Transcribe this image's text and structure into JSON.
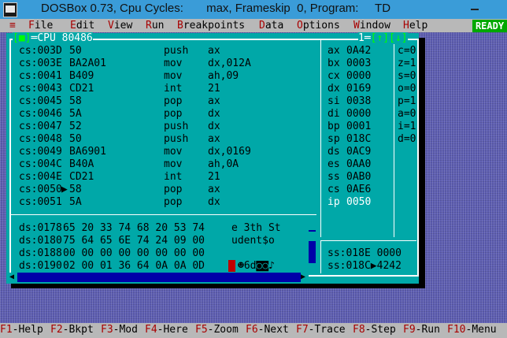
{
  "window": {
    "title": "DOSBox 0.73, Cpu Cycles:       max, Frameskip  0, Program:     TD"
  },
  "menu": {
    "system": "≡",
    "items": [
      {
        "hot": "F",
        "rest": "ile"
      },
      {
        "hot": "E",
        "rest": "dit"
      },
      {
        "hot": "V",
        "rest": "iew"
      },
      {
        "hot": "R",
        "rest": "un"
      },
      {
        "hot": "B",
        "rest": "reakpoints"
      },
      {
        "hot": "D",
        "rest": "ata"
      },
      {
        "hot": "O",
        "rest": "ptions"
      },
      {
        "hot": "W",
        "rest": "indow"
      },
      {
        "hot": "H",
        "rest": "elp"
      }
    ],
    "status": "READY"
  },
  "cpu_window": {
    "close": "[■]",
    "title": "CPU 80486",
    "number": "1",
    "controls": "[↑][↓]",
    "code": [
      {
        "addr": "cs:003D",
        "hex": "50",
        "mn": "push",
        "op": "ax"
      },
      {
        "addr": "cs:003E",
        "hex": "BA2A01",
        "mn": "mov",
        "op": "dx,012A"
      },
      {
        "addr": "cs:0041",
        "hex": "B409",
        "mn": "mov",
        "op": "ah,09"
      },
      {
        "addr": "cs:0043",
        "hex": "CD21",
        "mn": "int",
        "op": "21"
      },
      {
        "addr": "cs:0045",
        "hex": "58",
        "mn": "pop",
        "op": "ax"
      },
      {
        "addr": "cs:0046",
        "hex": "5A",
        "mn": "pop",
        "op": "dx"
      },
      {
        "addr": "cs:0047",
        "hex": "52",
        "mn": "push",
        "op": "dx"
      },
      {
        "addr": "cs:0048",
        "hex": "50",
        "mn": "push",
        "op": "ax"
      },
      {
        "addr": "cs:0049",
        "hex": "BA6901",
        "mn": "mov",
        "op": "dx,0169"
      },
      {
        "addr": "cs:004C",
        "hex": "B40A",
        "mn": "mov",
        "op": "ah,0A"
      },
      {
        "addr": "cs:004E",
        "hex": "CD21",
        "mn": "int",
        "op": "21"
      },
      {
        "addr": "cs:0050",
        "hex": "58",
        "mn": "pop",
        "op": "ax",
        "current": true
      },
      {
        "addr": "cs:0051",
        "hex": "5A",
        "mn": "pop",
        "op": "dx"
      }
    ],
    "registers": [
      {
        "name": "ax",
        "value": "0A42"
      },
      {
        "name": "bx",
        "value": "0003"
      },
      {
        "name": "cx",
        "value": "0000"
      },
      {
        "name": "dx",
        "value": "0169"
      },
      {
        "name": "si",
        "value": "0038"
      },
      {
        "name": "di",
        "value": "0000"
      },
      {
        "name": "bp",
        "value": "0001"
      },
      {
        "name": "sp",
        "value": "018C"
      },
      {
        "name": "ds",
        "value": "0AC9"
      },
      {
        "name": "es",
        "value": "0AA0"
      },
      {
        "name": "ss",
        "value": "0AB0"
      },
      {
        "name": "cs",
        "value": "0AE6"
      },
      {
        "name": "ip",
        "value": "0050"
      }
    ],
    "flags": [
      "c=0",
      "z=1",
      "s=0",
      "o=0",
      "p=1",
      "a=0",
      "i=1",
      "d=0"
    ],
    "dump": [
      {
        "addr": "ds:0178",
        "hex": "65 20 33 74 68 20 53 74",
        "ascii": "e 3th St"
      },
      {
        "addr": "ds:0180",
        "hex": "75 64 65 6E 74 24 09 00",
        "ascii": "udent$o "
      },
      {
        "addr": "ds:0188",
        "hex": "00 00 00 00 00 00 00 00",
        "ascii": ""
      },
      {
        "addr": "ds:0190",
        "hex": "02 00 01 36 64 0A 0A 0D",
        "ascii": "☻6d◙◙♪"
      }
    ],
    "stack": [
      {
        "addr": "ss:018E",
        "value": "0000"
      },
      {
        "addr": "ss:018C",
        "value": "4242",
        "current": true
      }
    ]
  },
  "function_keys": [
    {
      "key": "F1",
      "label": "Help"
    },
    {
      "key": "F2",
      "label": "Bkpt"
    },
    {
      "key": "F3",
      "label": "Mod"
    },
    {
      "key": "F4",
      "label": "Here"
    },
    {
      "key": "F5",
      "label": "Zoom"
    },
    {
      "key": "F6",
      "label": "Next"
    },
    {
      "key": "F7",
      "label": "Trace"
    },
    {
      "key": "F8",
      "label": "Step"
    },
    {
      "key": "F9",
      "label": "Run"
    },
    {
      "key": "F10",
      "label": "Menu"
    }
  ]
}
